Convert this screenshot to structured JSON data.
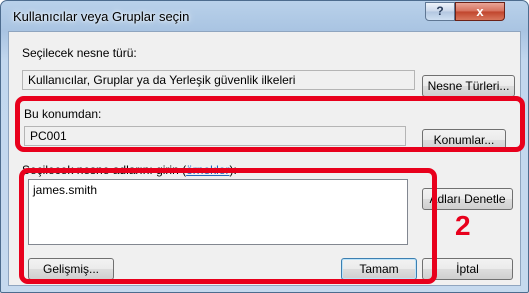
{
  "window": {
    "title": "Kullanıcılar veya Gruplar seçin",
    "help_glyph": "?",
    "close_glyph": "x"
  },
  "object_type": {
    "label": "Seçilecek nesne türü:",
    "value": "Kullanıcılar, Gruplar ya da Yerleşik güvenlik ilkeleri",
    "button": "Nesne Türleri..."
  },
  "location": {
    "label": "Bu konumdan:",
    "value": "PC001",
    "button": "Konumlar..."
  },
  "object_names": {
    "label": "Seçilecek nesne adlarını girin",
    "examples_link": "örnekler",
    "label_open": "(",
    "label_close": "):",
    "value": "james.smith",
    "check_button": "Adları Denetle"
  },
  "footer": {
    "advanced_button": "Gelişmiş...",
    "ok_button": "Tamam",
    "cancel_button": "İptal"
  },
  "annotation": {
    "step_number": "2",
    "color": "#e8001c"
  }
}
